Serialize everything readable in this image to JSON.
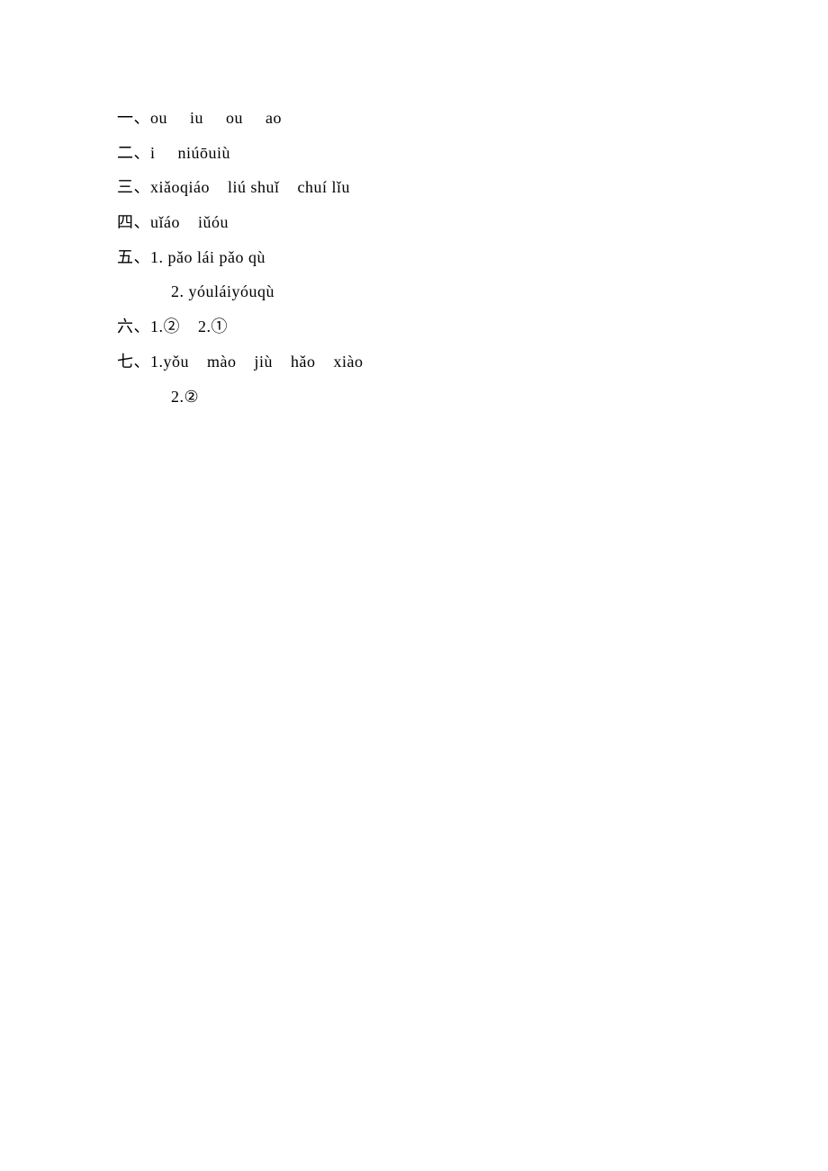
{
  "answers": {
    "one": {
      "label": "一、",
      "content": "ou     iu     ou     ao"
    },
    "two": {
      "label": "二、",
      "content": "i     niúōuiù"
    },
    "three": {
      "label": "三、",
      "content": "xiǎoqiáo    liú shuǐ    chuí lǐu"
    },
    "four": {
      "label": "四、",
      "content": "uǐáo    iǔóu"
    },
    "five": {
      "label": "五、",
      "line1": "1. pǎo lái pǎo qù",
      "line2": "2. yóuláiyóuqù"
    },
    "six": {
      "label": "六、",
      "content": "1.②    2.①"
    },
    "seven": {
      "label": "七、",
      "line1": "1.yǒu    mào    jiù    hǎo    xiào",
      "line2": "2.②"
    }
  }
}
